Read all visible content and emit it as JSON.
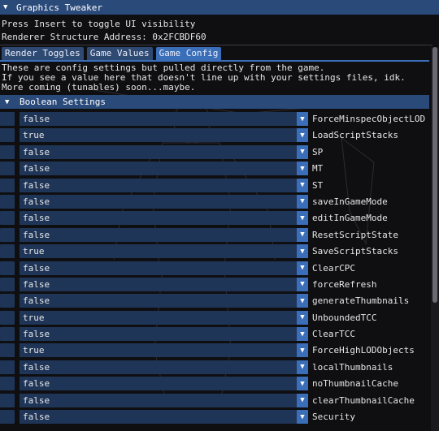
{
  "window": {
    "title": "Graphics Tweaker"
  },
  "info": {
    "line1": "Press Insert to toggle UI visibility",
    "line2": "Renderer Structure Address: 0x2FCBDF60"
  },
  "tabs": [
    {
      "label": "Render Toggles",
      "active": false
    },
    {
      "label": "Game Values",
      "active": false
    },
    {
      "label": "Game Config",
      "active": true
    }
  ],
  "description": {
    "line1": "These are config settings but pulled directly from the game.",
    "line2": "If you see a value here that doesn't line up with your settings files, idk.",
    "line3": "More coming (tunables) soon...maybe."
  },
  "section": {
    "title": "Boolean Settings"
  },
  "settings": [
    {
      "value": "false",
      "name": "ForceMinspecObjectLOD"
    },
    {
      "value": "true",
      "name": "LoadScriptStacks"
    },
    {
      "value": "false",
      "name": "SP"
    },
    {
      "value": "false",
      "name": "MT"
    },
    {
      "value": "false",
      "name": "ST"
    },
    {
      "value": "false",
      "name": "saveInGameMode"
    },
    {
      "value": "false",
      "name": "editInGameMode"
    },
    {
      "value": "false",
      "name": "ResetScriptState"
    },
    {
      "value": "true",
      "name": "SaveScriptStacks"
    },
    {
      "value": "false",
      "name": "ClearCPC"
    },
    {
      "value": "false",
      "name": "forceRefresh"
    },
    {
      "value": "false",
      "name": "generateThumbnails"
    },
    {
      "value": "true",
      "name": "UnboundedTCC"
    },
    {
      "value": "false",
      "name": "ClearTCC"
    },
    {
      "value": "true",
      "name": "ForceHighLODObjects"
    },
    {
      "value": "false",
      "name": "localThumbnails"
    },
    {
      "value": "false",
      "name": "noThumbnailCache"
    },
    {
      "value": "false",
      "name": "clearThumbnailCache"
    },
    {
      "value": "false",
      "name": "Security"
    }
  ],
  "icons": {
    "collapse": "triangle-down-icon",
    "dropdown": "triangle-down-icon"
  },
  "colors": {
    "title_bar": "#2a4a7a",
    "tab_active": "#3a6eb8",
    "tab_inactive": "#2e4a72",
    "field_bg": "#1f3557",
    "background": "#0f0f12"
  }
}
